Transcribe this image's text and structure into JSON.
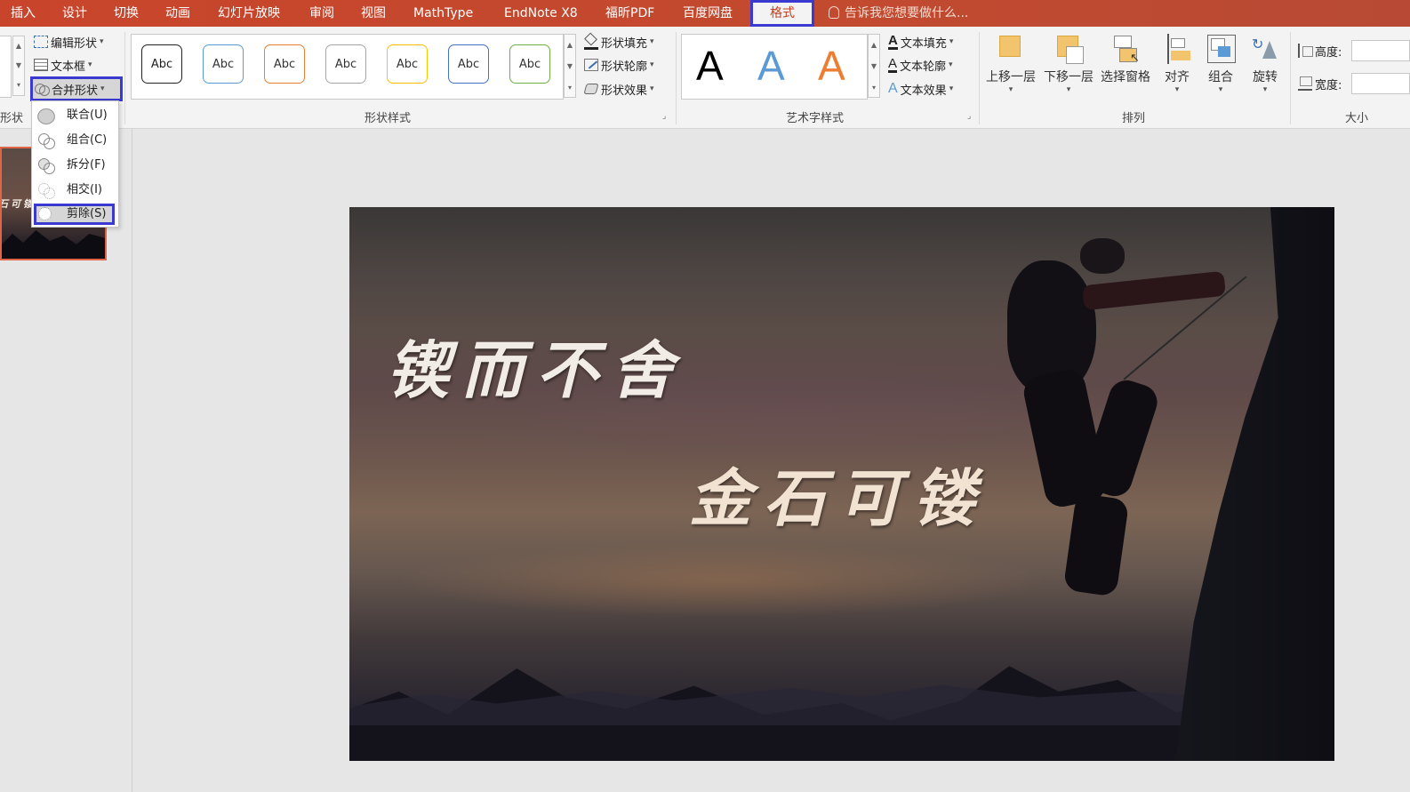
{
  "tabs": [
    {
      "label": "插入"
    },
    {
      "label": "设计"
    },
    {
      "label": "切换"
    },
    {
      "label": "动画"
    },
    {
      "label": "幻灯片放映"
    },
    {
      "label": "审阅"
    },
    {
      "label": "视图"
    },
    {
      "label": "MathType"
    },
    {
      "label": "EndNote X8"
    },
    {
      "label": "福昕PDF"
    },
    {
      "label": "百度网盘"
    },
    {
      "label": "格式",
      "active": true
    }
  ],
  "tellme": {
    "placeholder": "告诉我您想要做什么..."
  },
  "insert_shapes": {
    "edit_shape": "编辑形状",
    "text_box": "文本框",
    "merge_shapes": "合并形状",
    "group_label": "形状"
  },
  "merge_menu": {
    "items": [
      {
        "label": "联合(U)"
      },
      {
        "label": "组合(C)"
      },
      {
        "label": "拆分(F)"
      },
      {
        "label": "相交(I)"
      },
      {
        "label": "剪除(S)",
        "highlighted": true
      }
    ]
  },
  "shape_styles": {
    "group_label": "形状样式",
    "samples": [
      {
        "text": "Abc",
        "color": "#222222"
      },
      {
        "text": "Abc",
        "color": "#5b9bd5"
      },
      {
        "text": "Abc",
        "color": "#ed7d31"
      },
      {
        "text": "Abc",
        "color": "#a5a5a5"
      },
      {
        "text": "Abc",
        "color": "#ffc000"
      },
      {
        "text": "Abc",
        "color": "#4472c4"
      },
      {
        "text": "Abc",
        "color": "#70ad47"
      }
    ],
    "fill": "形状填充",
    "outline": "形状轮廓",
    "effects": "形状效果"
  },
  "wordart": {
    "group_label": "艺术字样式",
    "samples": [
      {
        "text": "A",
        "color": "#000000"
      },
      {
        "text": "A",
        "color": "#5b9bd5"
      },
      {
        "text": "A",
        "color": "#ed7d31"
      }
    ],
    "text_fill": "文本填充",
    "text_outline": "文本轮廓",
    "text_effects": "文本效果"
  },
  "arrange": {
    "group_label": "排列",
    "bring_forward": "上移一层",
    "send_backward": "下移一层",
    "selection_pane": "选择窗格",
    "align": "对齐",
    "group": "组合",
    "rotate": "旋转"
  },
  "size": {
    "group_label": "大小",
    "height_label": "高度:",
    "width_label": "宽度:"
  },
  "slide": {
    "line1": "锲而不舍",
    "line2": "金石可镂",
    "thumb_text": "石可镂"
  },
  "colors": {
    "brand": "#c43e1c",
    "highlight": "#3a3ad0"
  }
}
